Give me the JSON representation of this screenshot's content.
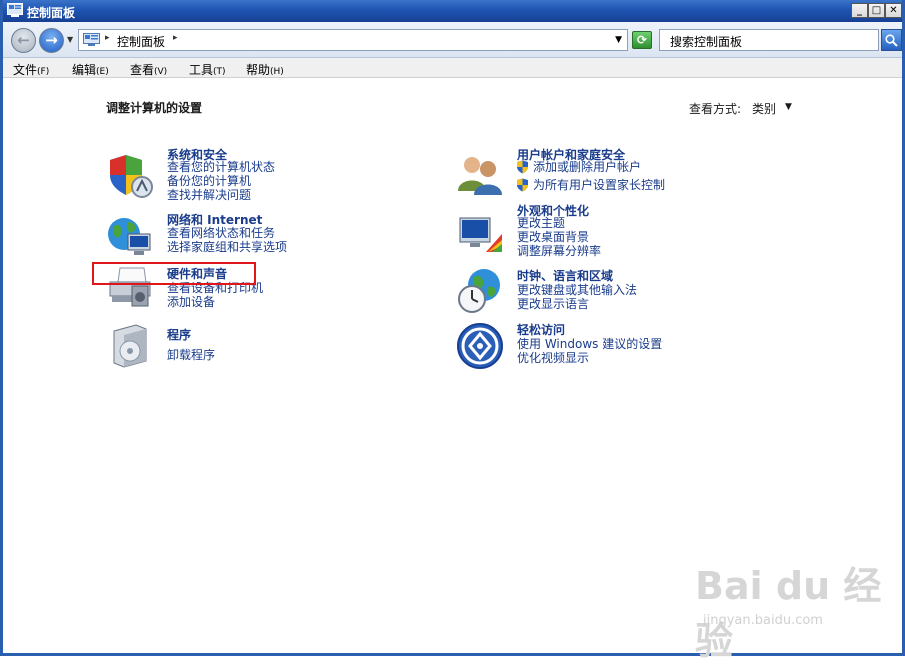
{
  "window": {
    "title": "控制面板"
  },
  "address": {
    "crumb": "控制面板"
  },
  "search": {
    "placeholder": "搜索控制面板"
  },
  "menu": [
    {
      "label": "文件",
      "accel": "(F)"
    },
    {
      "label": "编辑",
      "accel": "(E)"
    },
    {
      "label": "查看",
      "accel": "(V)"
    },
    {
      "label": "工具",
      "accel": "(T)"
    },
    {
      "label": "帮助",
      "accel": "(H)"
    }
  ],
  "page": {
    "title": "调整计算机的设置",
    "view_by_label": "查看方式:",
    "view_by_value": "类别"
  },
  "categories": {
    "system": {
      "title": "系统和安全",
      "links": [
        "查看您的计算机状态",
        "备份您的计算机",
        "查找并解决问题"
      ]
    },
    "network": {
      "title": "网络和 Internet",
      "links": [
        "查看网络状态和任务",
        "选择家庭组和共享选项"
      ]
    },
    "hardware": {
      "title": "硬件和声音",
      "links": [
        "查看设备和打印机",
        "添加设备"
      ]
    },
    "programs": {
      "title": "程序",
      "links": [
        "卸载程序"
      ]
    },
    "users": {
      "title": "用户帐户和家庭安全",
      "links": [
        "添加或删除用户帐户",
        "为所有用户设置家长控制"
      ]
    },
    "appearance": {
      "title": "外观和个性化",
      "links": [
        "更改主题",
        "更改桌面背景",
        "调整屏幕分辨率"
      ]
    },
    "clock": {
      "title": "时钟、语言和区域",
      "links": [
        "更改键盘或其他输入法",
        "更改显示语言"
      ]
    },
    "ease": {
      "title": "轻松访问",
      "links": [
        "使用 Windows 建议的设置",
        "优化视频显示"
      ]
    }
  },
  "watermark": {
    "brand": "Bai du 经验",
    "url": "jingyan.baidu.com"
  },
  "colors": {
    "link": "#1a3c8c",
    "titlebar": "#1f55b2",
    "highlight": "#e0161b"
  }
}
